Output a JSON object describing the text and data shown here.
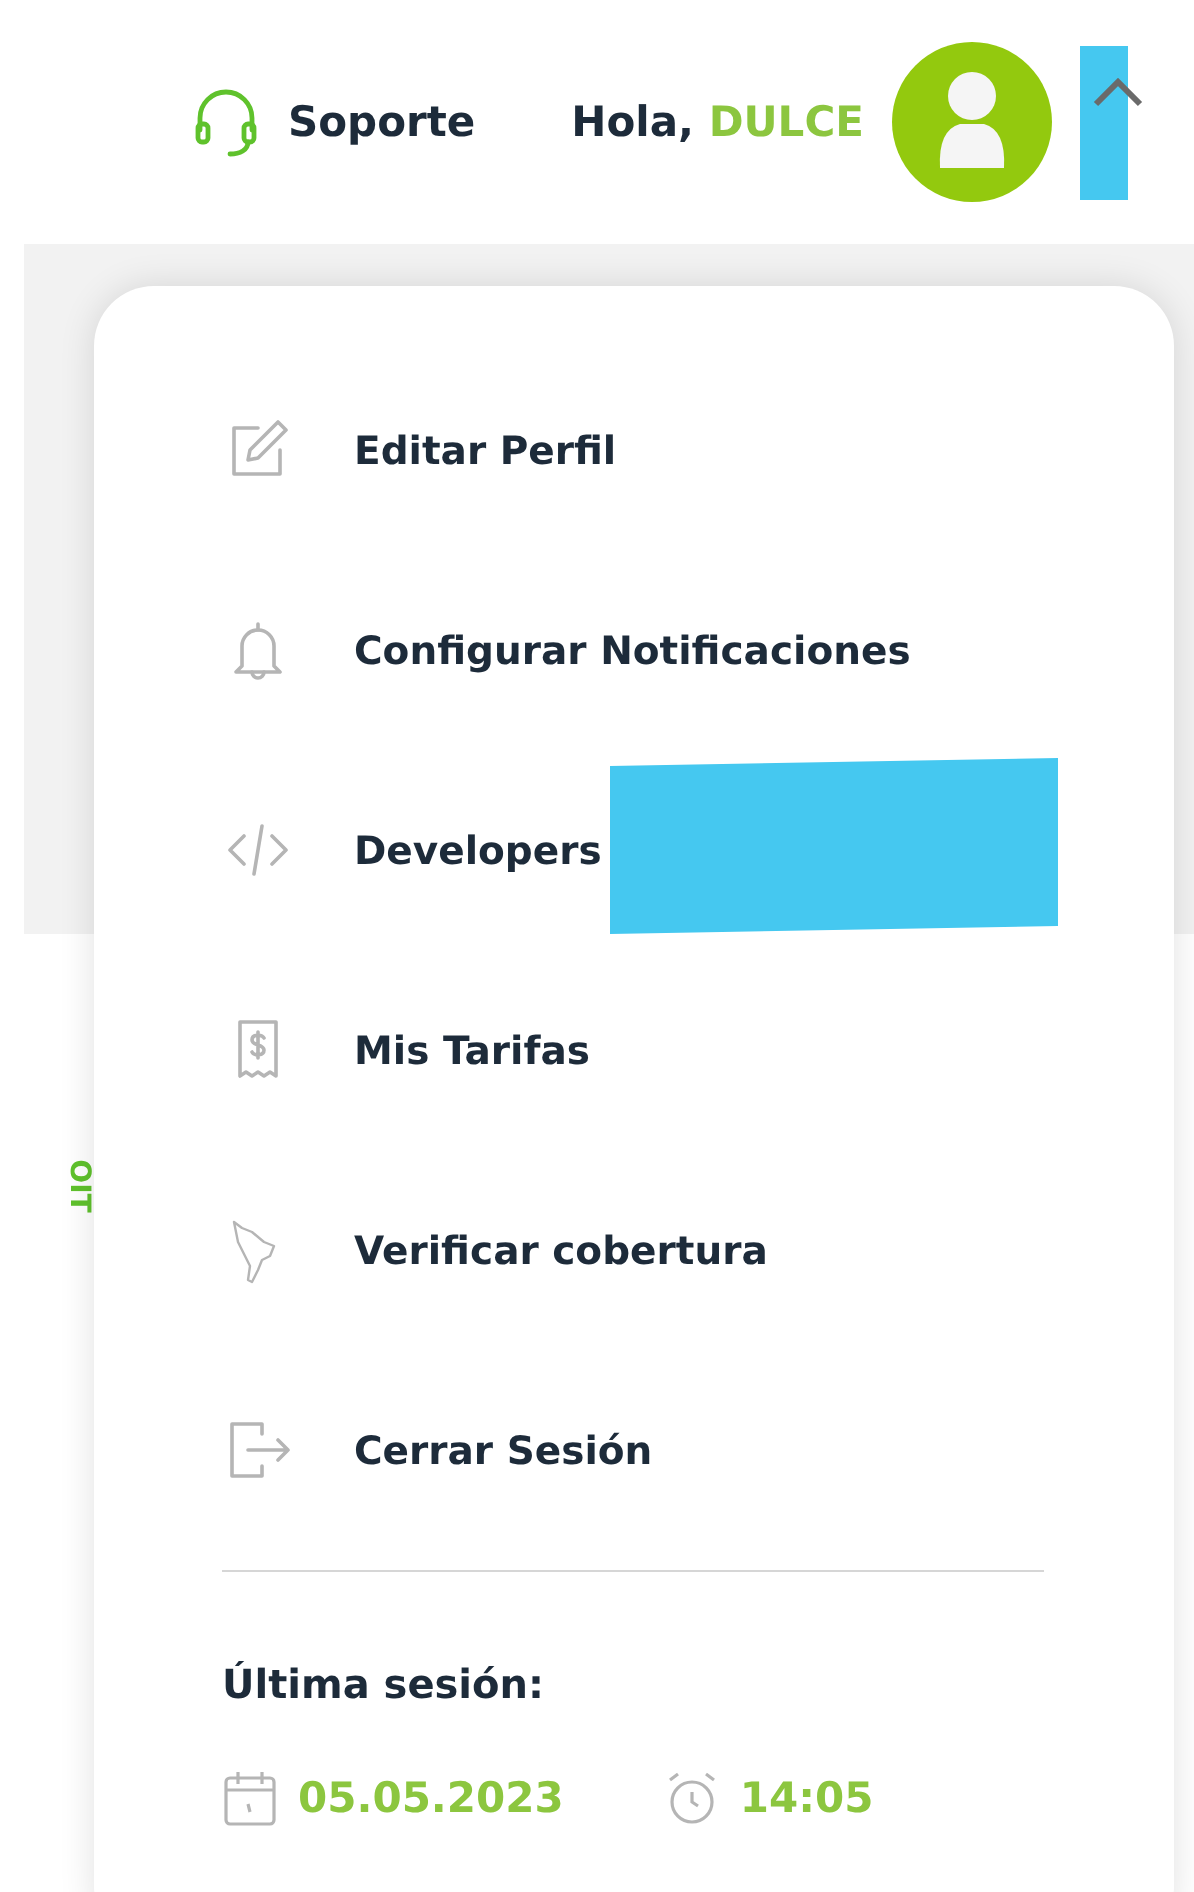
{
  "header": {
    "support": "Soporte",
    "greeting": "Hola,",
    "user_name": "DULCE",
    "menu_expanded": true
  },
  "side_text": "OIT",
  "menu": {
    "items": [
      {
        "kind": "edit",
        "label": "Editar Perfil",
        "redacted": false
      },
      {
        "kind": "bell",
        "label": "Configurar Notificaciones",
        "redacted": false
      },
      {
        "kind": "code",
        "label": "Developers",
        "redacted": true
      },
      {
        "kind": "receipt",
        "label": "Mis Tarifas",
        "redacted": false
      },
      {
        "kind": "map",
        "label": "Verificar cobertura",
        "redacted": false
      },
      {
        "kind": "logout",
        "label": "Cerrar Sesión",
        "redacted": false
      }
    ],
    "last_session": {
      "label": "Última sesión:",
      "date": "05.05.2023",
      "time": "14:05"
    }
  }
}
